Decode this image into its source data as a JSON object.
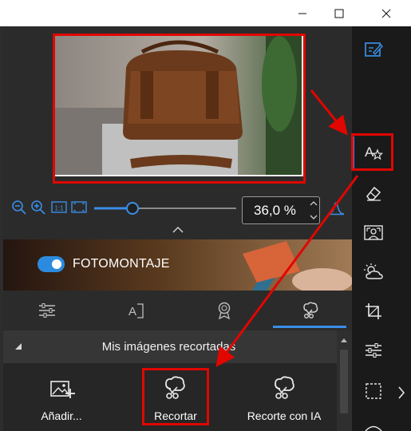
{
  "window": {
    "controls": {
      "minimize": "minimize",
      "maximize": "maximize",
      "close": "close"
    }
  },
  "preview": {
    "description_icon": "photo-thumbnail"
  },
  "zoom": {
    "value": "36,0 %",
    "slider_fraction": 0.27
  },
  "banner": {
    "label": "FOTOMONTAJE",
    "toggle_on": true
  },
  "tabs": [
    {
      "icon": "sliders-icon",
      "active": false
    },
    {
      "icon": "text-frame-icon",
      "active": false
    },
    {
      "icon": "badge-icon",
      "active": false
    },
    {
      "icon": "cutout-icon",
      "active": true
    }
  ],
  "section": {
    "title": "Mis imágenes recortadas"
  },
  "cards": [
    {
      "label": "Añadir..."
    },
    {
      "label": "Recortar"
    },
    {
      "label": "Recorte con IA"
    }
  ],
  "right_toolbar": [
    "edit-icon",
    "text-style-icon",
    "eraser-icon",
    "background-icon",
    "weather-icon",
    "crop-icon",
    "adjust-icon",
    "selection-icon"
  ],
  "colors": {
    "accent": "#3a8ee6",
    "highlight": "#e10600",
    "panel": "#2b2b2b"
  }
}
